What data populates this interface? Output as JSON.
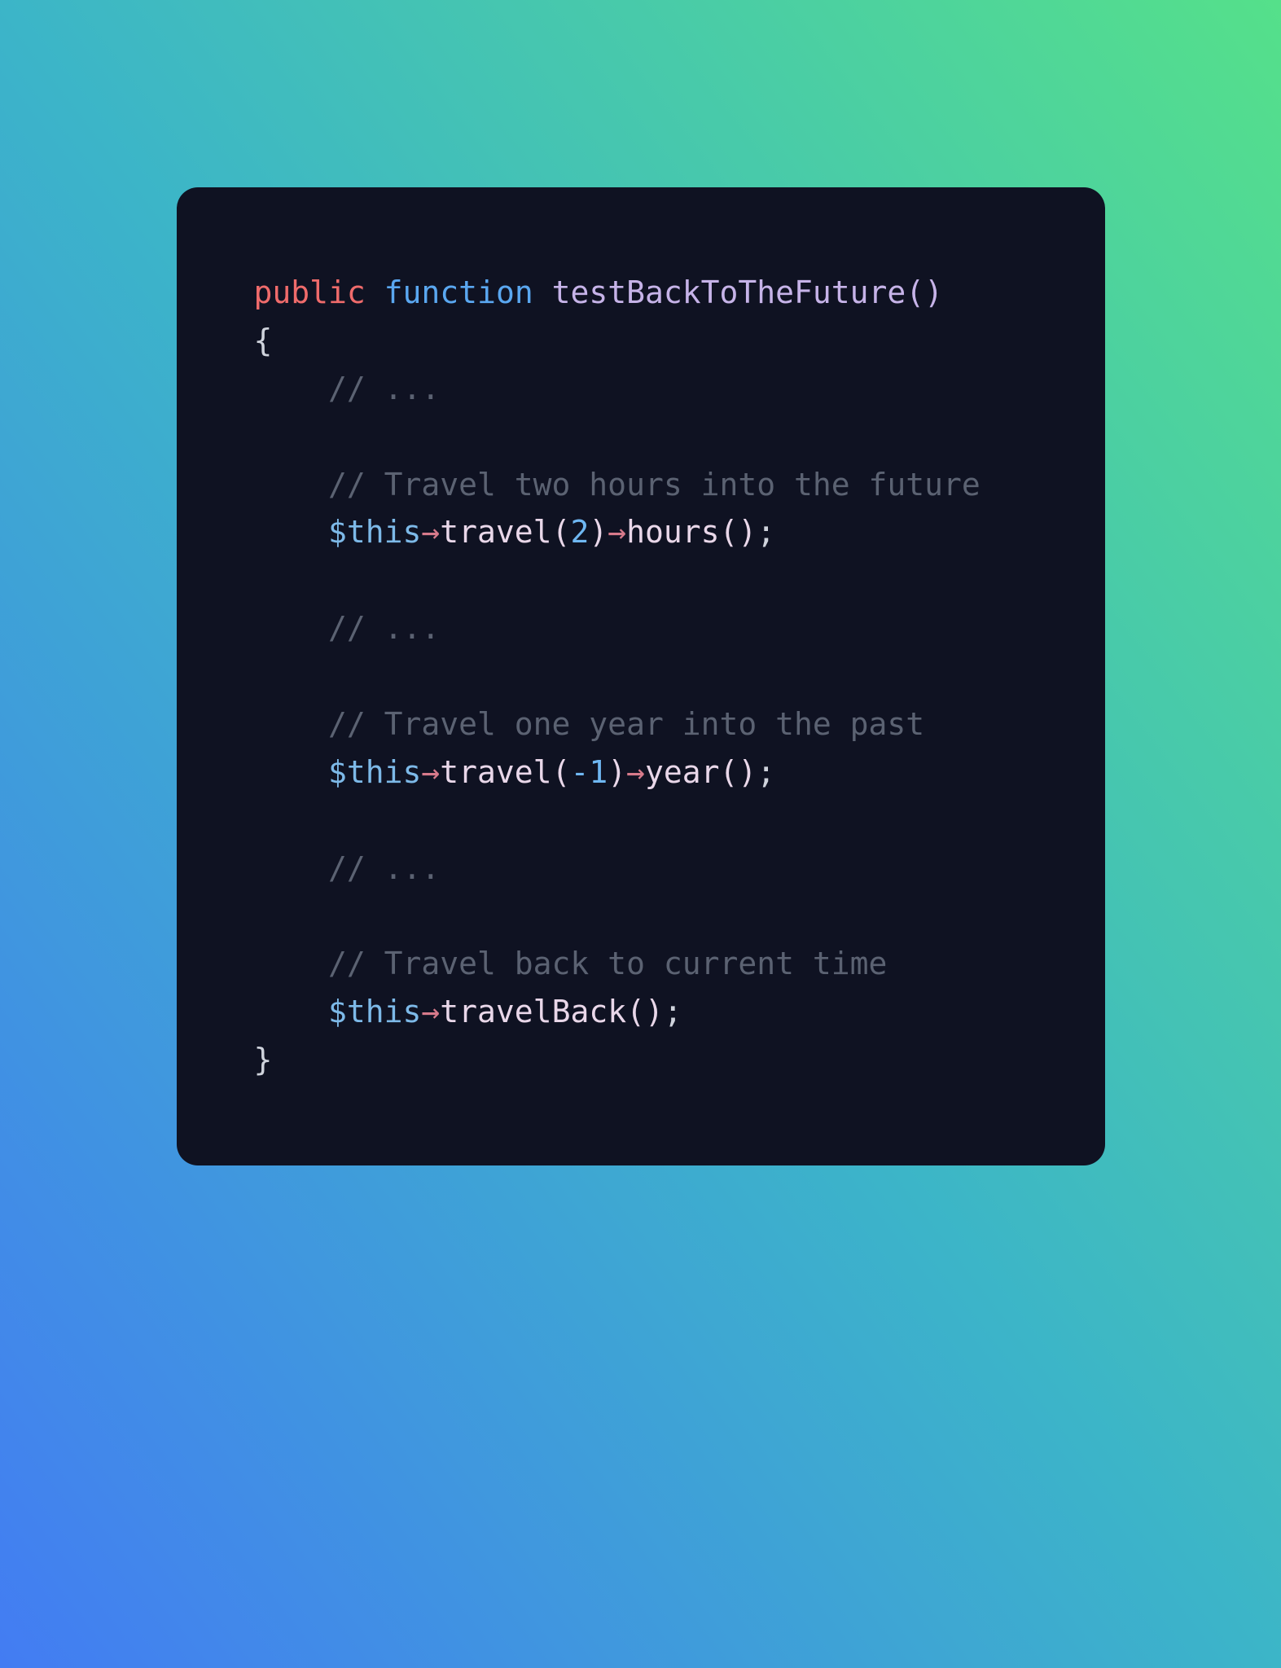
{
  "code": {
    "line1": {
      "public": "public",
      "function": "function",
      "name": "testBackToTheFuture",
      "parens": "()"
    },
    "line2": "{",
    "indent": "    ",
    "comment_ellipsis": "// ...",
    "comment_future": "// Travel two hours into the future",
    "expr_future": {
      "var": "$this",
      "arrow1": "→",
      "call1": "travel",
      "args1_open": "(",
      "args1_num": "2",
      "args1_close": ")",
      "arrow2": "→",
      "call2": "hours",
      "args2": "()",
      "semi": ";"
    },
    "comment_past": "// Travel one year into the past",
    "expr_past": {
      "var": "$this",
      "arrow1": "→",
      "call1": "travel",
      "args1_open": "(",
      "args1_num": "-1",
      "args1_close": ")",
      "arrow2": "→",
      "call2": "year",
      "args2": "()",
      "semi": ";"
    },
    "comment_back": "// Travel back to current time",
    "expr_back": {
      "var": "$this",
      "arrow1": "→",
      "call1": "travelBack",
      "args1": "()",
      "semi": ";"
    },
    "close": "}"
  }
}
